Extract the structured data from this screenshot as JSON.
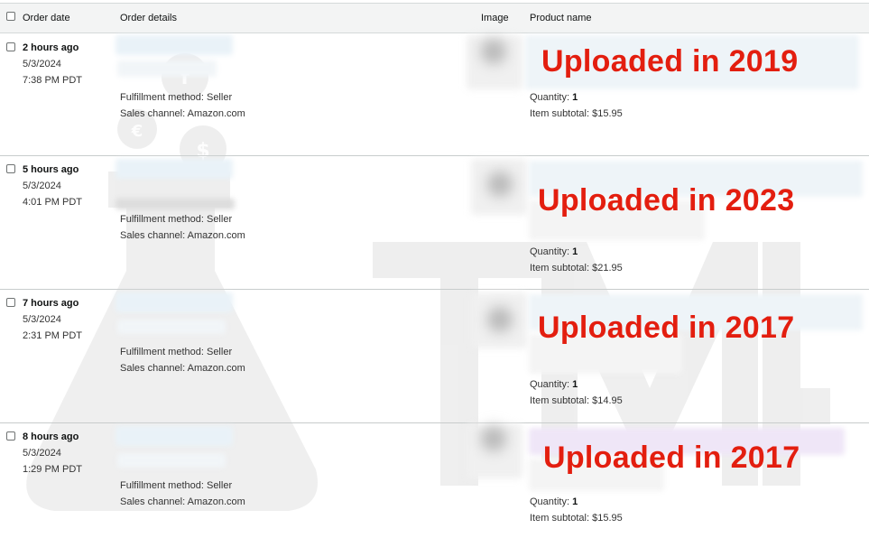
{
  "table": {
    "headers": {
      "order_date": "Order date",
      "order_details": "Order details",
      "image": "Image",
      "product_name": "Product name"
    },
    "orders": [
      {
        "age": "2 hours ago",
        "date": "5/3/2024",
        "time": "7:38 PM PDT",
        "fulfillment": "Fulfillment method: Seller",
        "channel": "Sales channel: Amazon.com",
        "quantity_label": "Quantity:",
        "quantity": "1",
        "subtotal": "Item subtotal: $15.95",
        "overlay": "Uploaded in 2019"
      },
      {
        "age": "5 hours ago",
        "date": "5/3/2024",
        "time": "4:01 PM PDT",
        "fulfillment": "Fulfillment method: Seller",
        "channel": "Sales channel: Amazon.com",
        "quantity_label": "Quantity:",
        "quantity": "1",
        "subtotal": "Item subtotal: $21.95",
        "overlay": "Uploaded in 2023"
      },
      {
        "age": "7 hours ago",
        "date": "5/3/2024",
        "time": "2:31 PM PDT",
        "fulfillment": "Fulfillment method: Seller",
        "channel": "Sales channel: Amazon.com",
        "quantity_label": "Quantity:",
        "quantity": "1",
        "subtotal": "Item subtotal: $14.95",
        "overlay": "Uploaded in 2017"
      },
      {
        "age": "8 hours ago",
        "date": "5/3/2024",
        "time": "1:29 PM PDT",
        "fulfillment": "Fulfillment method: Seller",
        "channel": "Sales channel: Amazon.com",
        "quantity_label": "Quantity:",
        "quantity": "1",
        "subtotal": "Item subtotal: $15.95",
        "overlay": "Uploaded in 2017"
      }
    ]
  },
  "colors": {
    "overlay_text": "#e31e0f",
    "header_bg": "#f3f4f4",
    "watermark": "#ececec"
  },
  "watermark": {
    "icon": "flask-icon",
    "lettering": "TML"
  }
}
